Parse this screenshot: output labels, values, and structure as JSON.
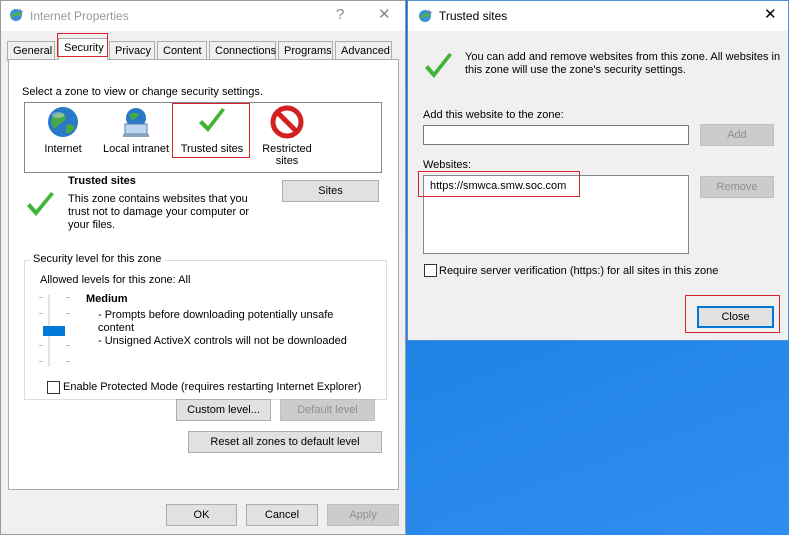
{
  "main_window": {
    "title": "Internet Properties",
    "help_glyph": "?",
    "close_glyph": "✕",
    "tabs": [
      "General",
      "Security",
      "Privacy",
      "Content",
      "Connections",
      "Programs",
      "Advanced"
    ],
    "active_tab": "Security",
    "instruction": "Select a zone to view or change security settings.",
    "zones": [
      {
        "label": "Internet",
        "icon": "globe-icon"
      },
      {
        "label": "Local intranet",
        "icon": "network-computer-icon"
      },
      {
        "label": "Trusted sites",
        "icon": "checkmark-icon"
      },
      {
        "label_line1": "Restricted",
        "label_line2": "sites",
        "icon": "restricted-icon"
      }
    ],
    "selected_zone_title": "Trusted sites",
    "selected_zone_desc_1": "This zone contains websites that you",
    "selected_zone_desc_2": "trust not to damage your computer or",
    "selected_zone_desc_3": "your files.",
    "sites_button": "Sites",
    "security_group_label": "Security level for this zone",
    "allowed_levels": "Allowed levels for this zone: All",
    "level_name": "Medium",
    "level_desc_1": "- Prompts before downloading potentially unsafe",
    "level_desc_1b": "content",
    "level_desc_2": "- Unsigned ActiveX controls will not be downloaded",
    "protected_mode": "Enable Protected Mode (requires restarting Internet Explorer)",
    "custom_level_button": "Custom level...",
    "default_level_button": "Default level",
    "reset_all_button": "Reset all zones to default level",
    "ok_button": "OK",
    "cancel_button": "Cancel",
    "apply_button": "Apply"
  },
  "trusted_dialog": {
    "title": "Trusted sites",
    "close_glyph": "✕",
    "info_line_1": "You can add and remove websites from this zone. All websites in",
    "info_line_2": "this zone will use the zone's security settings.",
    "add_label": "Add this website to the zone:",
    "add_input_value": "",
    "add_button": "Add",
    "websites_label": "Websites:",
    "websites": [
      "https://smwca.smw.soc.com"
    ],
    "remove_button": "Remove",
    "require_verification": "Require server verification (https:) for all sites in this zone",
    "close_button": "Close"
  },
  "colors": {
    "desktop": "#1a7fe0",
    "highlight_box": "#d9222a",
    "slider_thumb": "#0078d7",
    "check_green": "#3fb536"
  }
}
